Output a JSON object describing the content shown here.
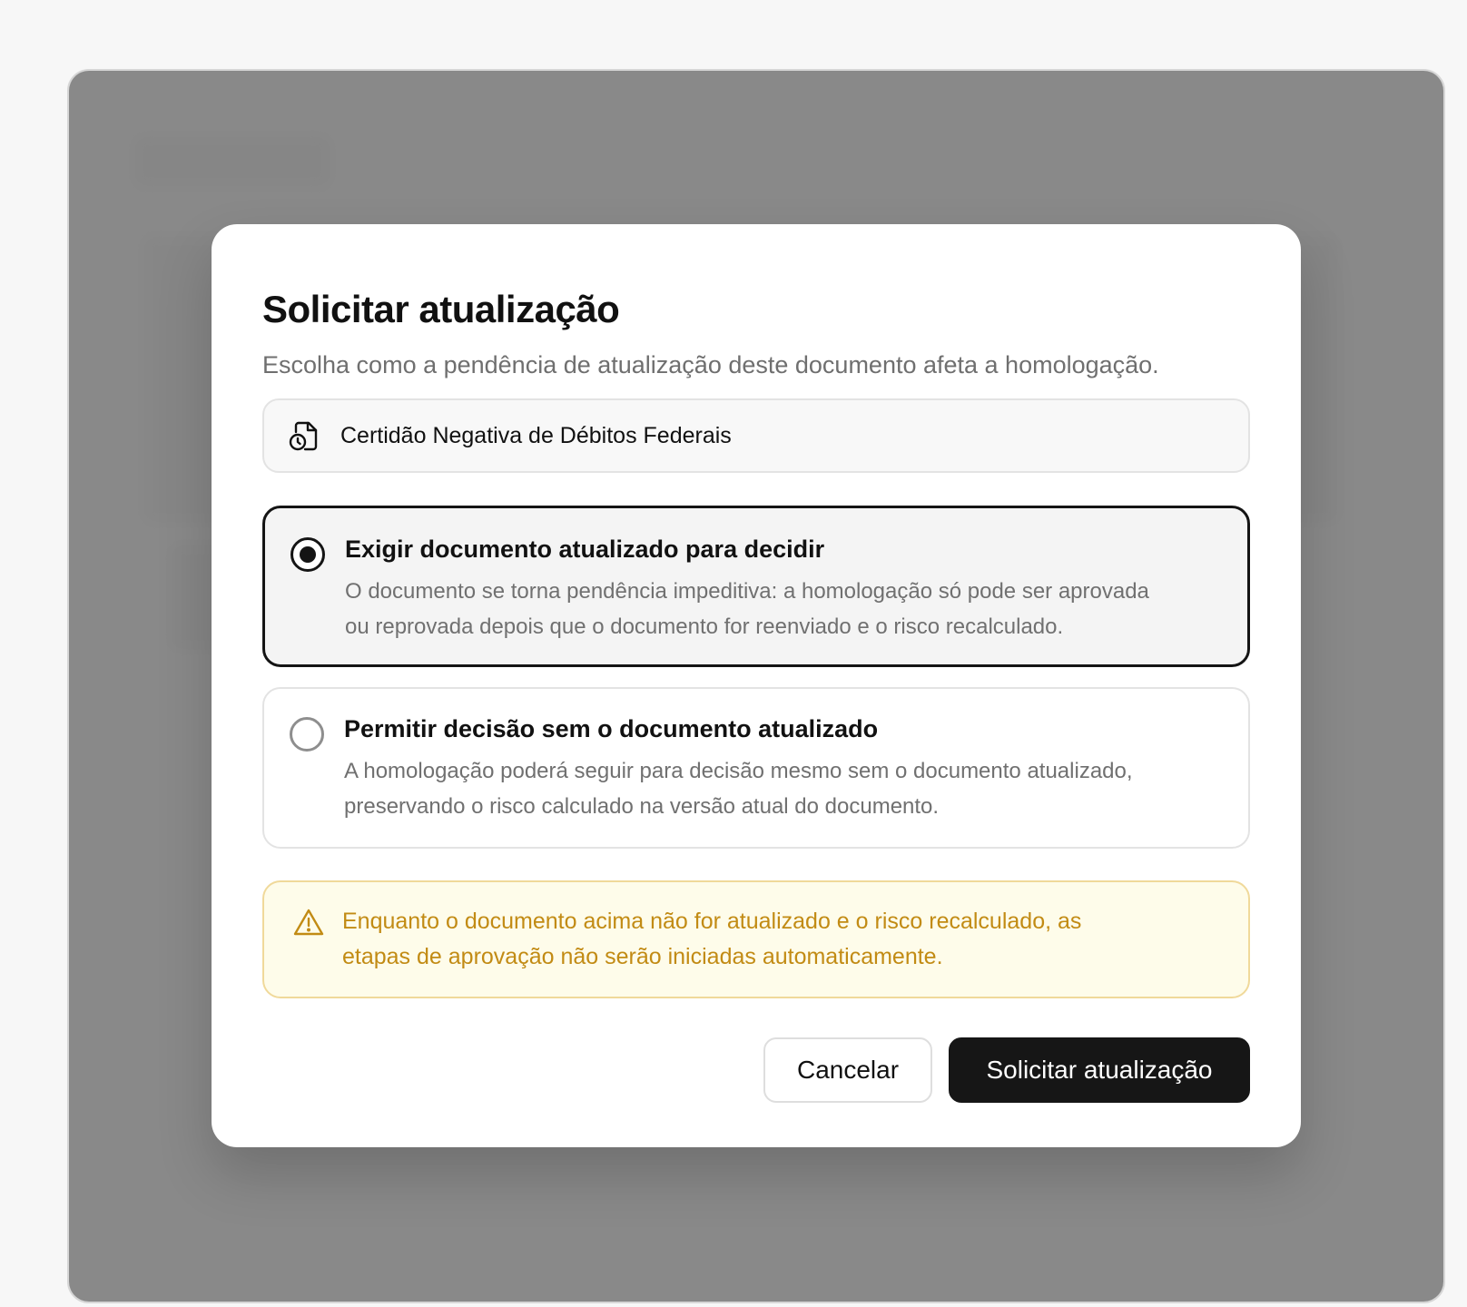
{
  "modal": {
    "title": "Solicitar atualização",
    "subtitle": "Escolha como a pendência de atualização deste documento afeta a homologação.",
    "document_name": "Certidão Negativa de Débitos Federais",
    "document_icon": "document-clock-icon",
    "options": [
      {
        "title": "Exigir documento atualizado para decidir",
        "description_line1": "O documento se torna pendência impeditiva: a homologação só pode ser aprovada",
        "description_line2": "ou reprovada depois que o documento for reenviado e o risco recalculado.",
        "selected": true
      },
      {
        "title": "Permitir decisão sem o documento atualizado",
        "description_line1": "A homologação poderá seguir para decisão mesmo sem o documento atualizado,",
        "description_line2": "preservando o risco calculado na versão atual do documento.",
        "selected": false
      }
    ],
    "warning": {
      "icon": "warning-triangle-icon",
      "line1": "Enquanto o documento acima não for atualizado e o risco recalculado, as",
      "line2": "etapas de aprovação não serão iniciadas automaticamente.",
      "color": "#c28b14"
    },
    "buttons": {
      "cancel": "Cancelar",
      "submit": "Solicitar atualização"
    }
  },
  "colors": {
    "primary": "#161616",
    "warning_bg": "#fefcea",
    "warning_border": "#f0d99a"
  }
}
